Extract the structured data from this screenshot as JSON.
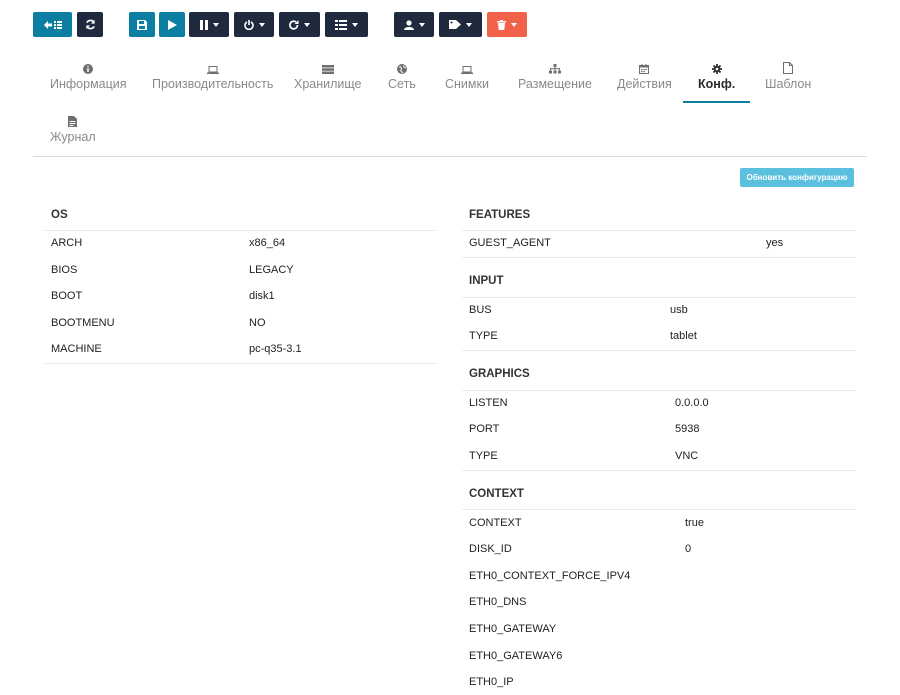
{
  "colors": {
    "teal": "#0b7ea1",
    "dark": "#1f2a3e",
    "red": "#f2624a",
    "info": "#5bc0de"
  },
  "toolbar": {
    "buttons": [
      {
        "name": "back-to-list-button",
        "icon": "arrow-left-list-icon"
      },
      {
        "name": "refresh-button",
        "icon": "refresh-icon"
      },
      {
        "name": "save-button",
        "icon": "floppy-disk-icon"
      },
      {
        "name": "play-button",
        "icon": "play-icon"
      },
      {
        "name": "pause-menu-button",
        "icon": "pause-icon"
      },
      {
        "name": "power-menu-button",
        "icon": "power-icon"
      },
      {
        "name": "reboot-menu-button",
        "icon": "redo-icon"
      },
      {
        "name": "list-menu-button",
        "icon": "list-icon"
      },
      {
        "name": "user-menu-button",
        "icon": "user-icon"
      },
      {
        "name": "tag-menu-button",
        "icon": "tag-icon"
      },
      {
        "name": "delete-menu-button",
        "icon": "trash-icon"
      }
    ]
  },
  "tabs": [
    {
      "label": "Информация",
      "icon": "info-circle-icon",
      "active": false
    },
    {
      "label": "Производительность",
      "icon": "laptop-icon",
      "active": false
    },
    {
      "label": "Хранилище",
      "icon": "hdd-icon",
      "active": false
    },
    {
      "label": "Сеть",
      "icon": "globe-icon",
      "active": false
    },
    {
      "label": "Снимки",
      "icon": "laptop-icon",
      "active": false
    },
    {
      "label": "Размещение",
      "icon": "sitemap-icon",
      "active": false
    },
    {
      "label": "Действия",
      "icon": "calendar-icon",
      "active": false
    },
    {
      "label": "Конф.",
      "icon": "cog-icon",
      "active": true
    },
    {
      "label": "Шаблон",
      "icon": "file-icon",
      "active": false
    },
    {
      "label": "Журнал",
      "icon": "file-text-icon",
      "active": false
    }
  ],
  "update_button": {
    "label": "Обновить конфигурацию"
  },
  "os": {
    "title": "OS",
    "rows": [
      {
        "key": "ARCH",
        "value": "x86_64"
      },
      {
        "key": "BIOS",
        "value": "LEGACY"
      },
      {
        "key": "BOOT",
        "value": "disk1"
      },
      {
        "key": "BOOTMENU",
        "value": "NO"
      },
      {
        "key": "MACHINE",
        "value": "pc-q35-3.1"
      }
    ]
  },
  "features": {
    "title": "FEATURES",
    "rows": [
      {
        "key": "GUEST_AGENT",
        "value": "yes"
      }
    ]
  },
  "input": {
    "title": "INPUT",
    "rows": [
      {
        "key": "BUS",
        "value": "usb"
      },
      {
        "key": "TYPE",
        "value": "tablet"
      }
    ]
  },
  "graphics": {
    "title": "GRAPHICS",
    "rows": [
      {
        "key": "LISTEN",
        "value": "0.0.0.0"
      },
      {
        "key": "PORT",
        "value": "5938"
      },
      {
        "key": "TYPE",
        "value": "VNC"
      }
    ]
  },
  "context": {
    "title": "CONTEXT",
    "rows": [
      {
        "key": "CONTEXT",
        "value": "true"
      },
      {
        "key": "DISK_ID",
        "value": "0"
      },
      {
        "key": "ETH0_CONTEXT_FORCE_IPV4",
        "value": ""
      },
      {
        "key": "ETH0_DNS",
        "value": ""
      },
      {
        "key": "ETH0_GATEWAY",
        "value": ""
      },
      {
        "key": "ETH0_GATEWAY6",
        "value": ""
      },
      {
        "key": "ETH0_IP",
        "value": ""
      }
    ]
  }
}
